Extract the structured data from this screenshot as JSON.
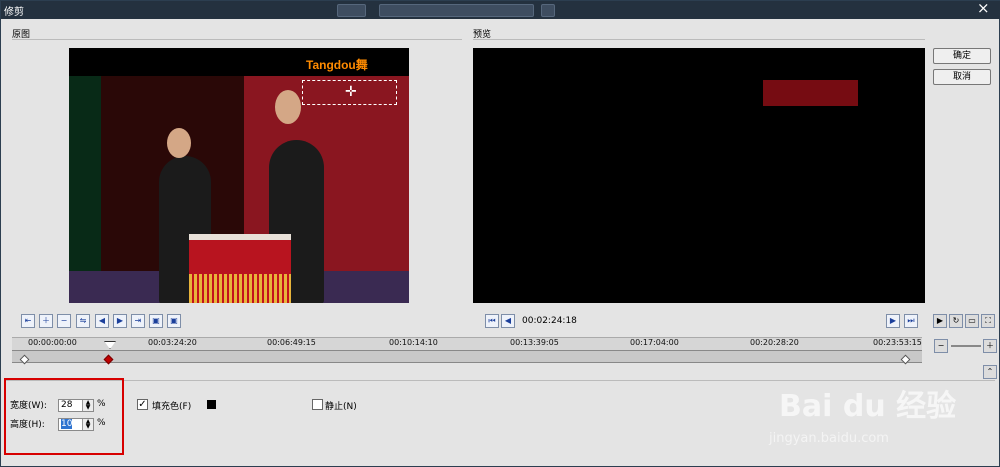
{
  "window": {
    "title": "修剪",
    "close_icon": "×"
  },
  "panels": {
    "source_label": "原图",
    "preview_label": "预览"
  },
  "source": {
    "logo": "Tangdou舞"
  },
  "buttons": {
    "ok": "确定",
    "cancel": "取消"
  },
  "playback": {
    "current_time": "00:02:24:18",
    "total_time_label": ""
  },
  "timeline": {
    "labels": [
      "00:00:00:00",
      "00:03:24:20",
      "00:06:49:15",
      "00:10:14:10",
      "00:13:39:05",
      "00:17:04:00",
      "00:20:28:20",
      "00:23:53:15"
    ]
  },
  "fields": {
    "width_label": "宽度(W):",
    "width_value": "28",
    "height_label": "高度(H):",
    "height_value": "10",
    "percent": "%",
    "fill_label": "填充色(F)",
    "fill_color": "#000000",
    "static_label": "静止(N)"
  },
  "watermark": {
    "main": "Bai du 经验",
    "sub": "jingyan.baidu.com"
  }
}
